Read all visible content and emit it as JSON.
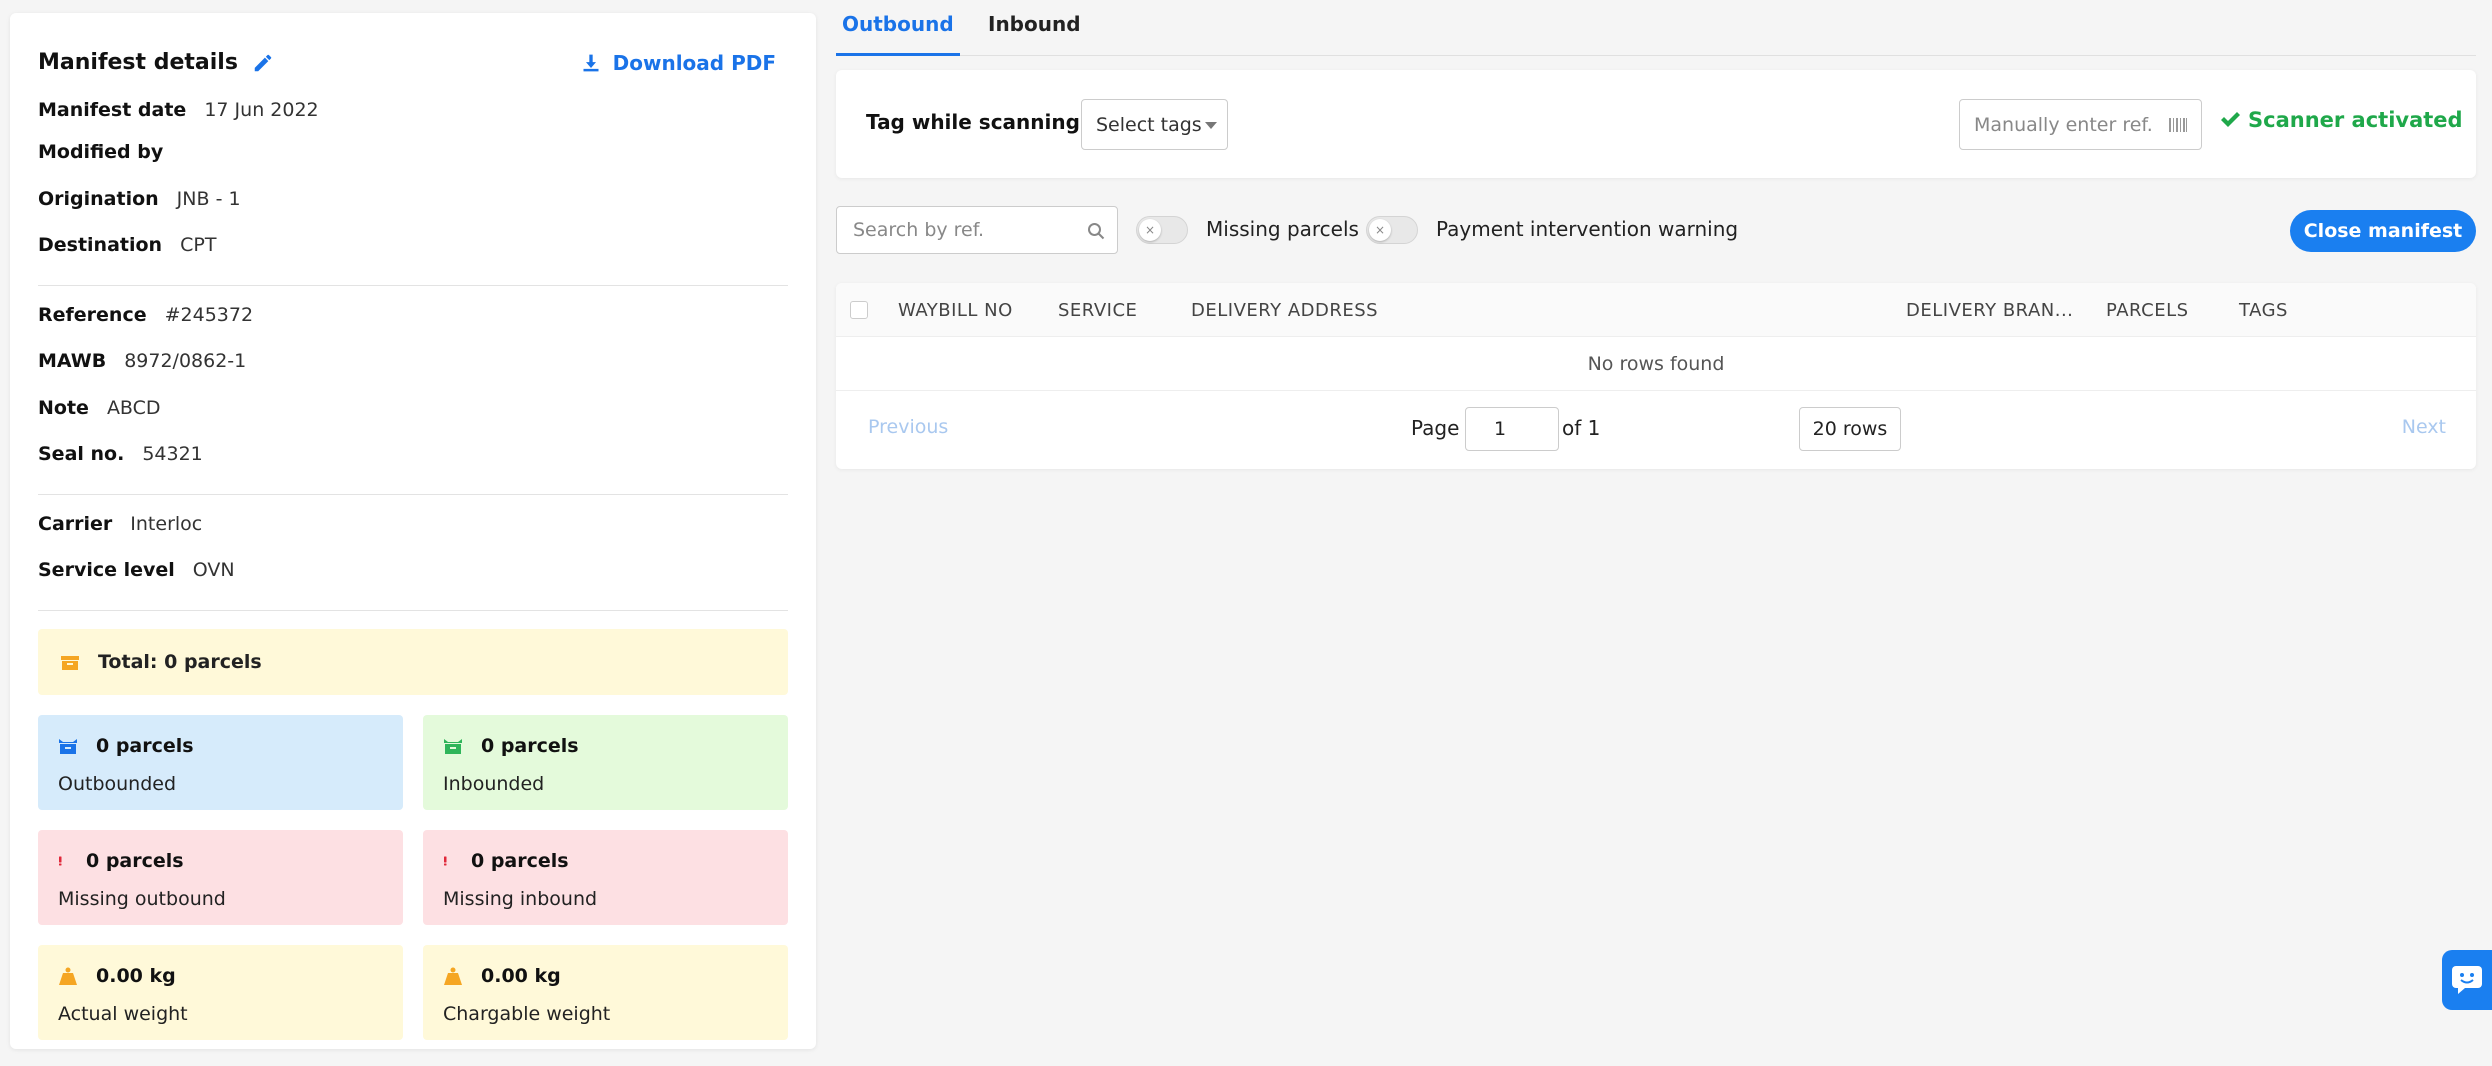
{
  "manifest": {
    "title": "Manifest details",
    "download_label": "Download PDF",
    "group1": [
      {
        "label": "Manifest date",
        "value": "17 Jun 2022"
      },
      {
        "label": "Modified by",
        "value": ""
      },
      {
        "label": "Origination",
        "value": "JNB - 1"
      },
      {
        "label": "Destination",
        "value": "CPT"
      }
    ],
    "group2": [
      {
        "label": "Reference",
        "value": "#245372"
      },
      {
        "label": "MAWB",
        "value": "8972/0862-1"
      },
      {
        "label": "Note",
        "value": "ABCD"
      },
      {
        "label": "Seal no.",
        "value": "54321"
      }
    ],
    "group3": [
      {
        "label": "Carrier",
        "value": "Interloc"
      },
      {
        "label": "Service level",
        "value": "OVN"
      }
    ],
    "total": "Total: 0 parcels",
    "stats": [
      {
        "value": "0 parcels",
        "label": "Outbounded",
        "icon": "box-icon",
        "color": "#1a73e8"
      },
      {
        "value": "0 parcels",
        "label": "Inbounded",
        "icon": "box-icon",
        "color": "#2fb55a"
      },
      {
        "value": "0 parcels",
        "label": "Missing outbound",
        "icon": "exclamation-icon",
        "color": "#e0283a"
      },
      {
        "value": "0 parcels",
        "label": "Missing inbound",
        "icon": "exclamation-icon",
        "color": "#e0283a"
      },
      {
        "value": "0.00 kg",
        "label": "Actual weight",
        "icon": "weight-icon",
        "color": "#f5a623"
      },
      {
        "value": "0.00 kg",
        "label": "Chargable weight",
        "icon": "weight-icon",
        "color": "#f5a623"
      }
    ]
  },
  "tabs": {
    "outbound": "Outbound",
    "inbound": "Inbound"
  },
  "scan": {
    "tag_label": "Tag while scanning",
    "select_tags": "Select tags",
    "manual_placeholder": "Manually enter ref.",
    "scanner_status": "Scanner activated"
  },
  "filters": {
    "search_placeholder": "Search by ref.",
    "missing_parcels": "Missing parcels",
    "payment_warning": "Payment intervention warning",
    "close_manifest": "Close manifest"
  },
  "table": {
    "columns": [
      "WAYBILL NO",
      "SERVICE",
      "DELIVERY ADDRESS",
      "DELIVERY BRAN...",
      "PARCELS",
      "TAGS"
    ],
    "empty": "No rows found"
  },
  "pager": {
    "previous": "Previous",
    "next": "Next",
    "page_label": "Page",
    "page_value": "1",
    "of_label": "of 1",
    "rows": "20 rows"
  },
  "colors": {
    "accent": "#1a73e8",
    "success": "#1fa84a"
  }
}
